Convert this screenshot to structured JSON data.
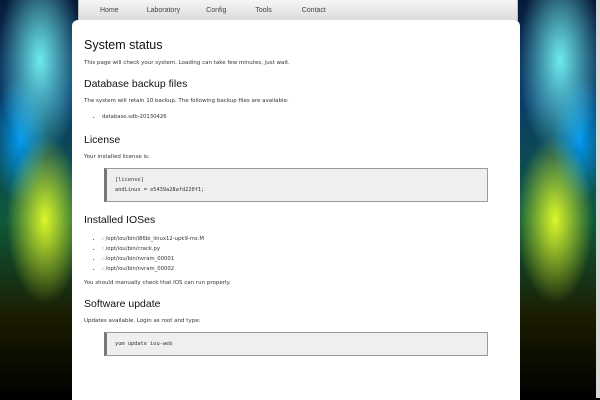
{
  "nav": {
    "items": [
      "Home",
      "Laboratory",
      "Config",
      "Tools",
      "Contact"
    ]
  },
  "content": {
    "title": "System status",
    "intro": "This page will check your system. Loading can take few minutes, just wait.",
    "backup": {
      "heading": "Database backup files",
      "text": "The system will retain 10 backup. The following backup files are available:",
      "files": [
        "database.sdb-20130426"
      ]
    },
    "license": {
      "heading": "License",
      "text": "Your installed license is:",
      "code": "[license]\nandLinux = e5439a28afd220f1;"
    },
    "ioses": {
      "heading": "Installed IOSes",
      "items": [
        ": /opt/iou/bin/i86bi_linux12-upk9-ms.M",
        ": /opt/iou/bin/crack.py",
        ": /opt/iou/bin/nvram_00001",
        ": /opt/iou/bin/nvram_00002"
      ],
      "note": "You should manually check that IOS can run properly."
    },
    "update": {
      "heading": "Software update",
      "text": "Updates available. Login as root and type:",
      "code": "yum update iou-web"
    }
  }
}
